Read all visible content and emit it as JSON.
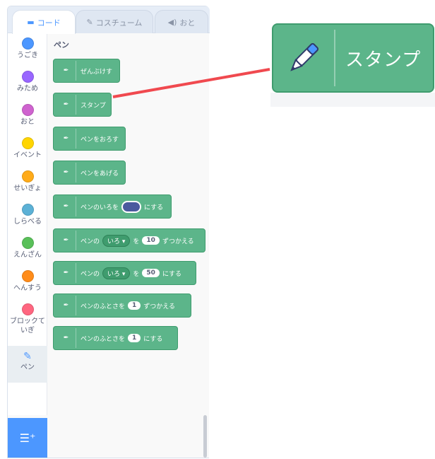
{
  "tabs": [
    {
      "label": "コード",
      "icon": "code-icon"
    },
    {
      "label": "コスチューム",
      "icon": "brush-icon"
    },
    {
      "label": "おと",
      "icon": "speaker-icon"
    }
  ],
  "categories": [
    {
      "label": "うごき",
      "color": "#4c97ff"
    },
    {
      "label": "みため",
      "color": "#9966ff"
    },
    {
      "label": "おと",
      "color": "#cf63cf"
    },
    {
      "label": "イベント",
      "color": "#ffd500"
    },
    {
      "label": "せいぎょ",
      "color": "#ffab19"
    },
    {
      "label": "しらべる",
      "color": "#5cb1d6"
    },
    {
      "label": "えんざん",
      "color": "#59c059"
    },
    {
      "label": "へんすう",
      "color": "#ff8c1a"
    },
    {
      "label": "ブロックて\nいぎ",
      "color": "#ff6680"
    },
    {
      "label": "ペン",
      "icon": "pen-icon"
    }
  ],
  "palette": {
    "heading": "ペン",
    "blocks": [
      {
        "text": "ぜんぶけす"
      },
      {
        "text": "スタンプ"
      },
      {
        "text": "ペンをおろす"
      },
      {
        "text": "ペンをあげる"
      },
      {
        "pre": "ペンのいろを",
        "swatch": "#4a5a9e",
        "post": "にする"
      },
      {
        "pre": "ペンの",
        "dropdown": "いろ ▾",
        "mid": "を",
        "value": "10",
        "post": "ずつかえる"
      },
      {
        "pre": "ペンの",
        "dropdown": "いろ ▾",
        "mid": "を",
        "value": "50",
        "post": "にする"
      },
      {
        "pre": "ペンのふとさを",
        "value": "1",
        "post": "ずつかえる"
      },
      {
        "pre": "ペンのふとさを",
        "value": "1",
        "post": "にする"
      }
    ]
  },
  "callout": {
    "label": "スタンプ",
    "color": "#f0494f"
  },
  "colors": {
    "block": "#5cb58a",
    "accent": "#4c97ff"
  }
}
